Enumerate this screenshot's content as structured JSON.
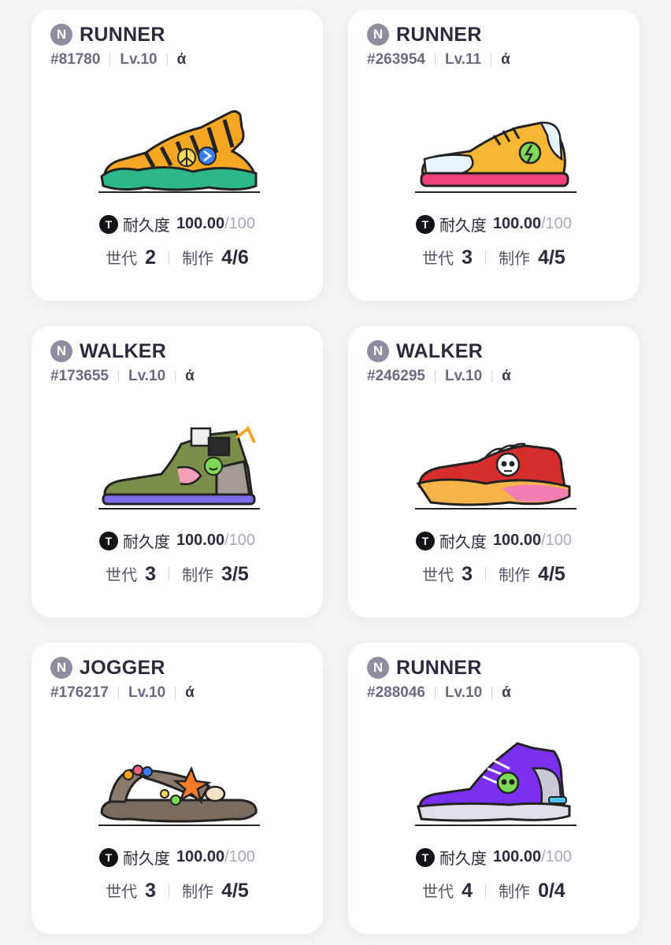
{
  "labels": {
    "durability": "耐久度",
    "generation": "世代",
    "mint": "制作",
    "durability_max": "/100",
    "brand_badge": "N",
    "token_badge": "T"
  },
  "cards": [
    {
      "type": "RUNNER",
      "id": "#81780",
      "level": "Lv.10",
      "gender": "ά",
      "durability": "100.00",
      "generation": "2",
      "mint": "4/6",
      "shoe": "tiger-runner-shoe"
    },
    {
      "type": "RUNNER",
      "id": "#263954",
      "level": "Lv.11",
      "gender": "ά",
      "durability": "100.00",
      "generation": "3",
      "mint": "4/5",
      "shoe": "pink-bolt-runner-shoe"
    },
    {
      "type": "WALKER",
      "id": "#173655",
      "level": "Lv.10",
      "gender": "ά",
      "durability": "100.00",
      "generation": "3",
      "mint": "3/5",
      "shoe": "smiley-patchwork-walker-shoe"
    },
    {
      "type": "WALKER",
      "id": "#246295",
      "level": "Lv.10",
      "gender": "ά",
      "durability": "100.00",
      "generation": "3",
      "mint": "4/5",
      "shoe": "skull-red-walker-shoe"
    },
    {
      "type": "JOGGER",
      "id": "#176217",
      "level": "Lv.10",
      "gender": "ά",
      "durability": "100.00",
      "generation": "3",
      "mint": "4/5",
      "shoe": "beach-sandal-shoe"
    },
    {
      "type": "RUNNER",
      "id": "#288046",
      "level": "Lv.10",
      "gender": "ά",
      "durability": "100.00",
      "generation": "4",
      "mint": "0/4",
      "shoe": "purple-skull-runner-shoe"
    }
  ]
}
